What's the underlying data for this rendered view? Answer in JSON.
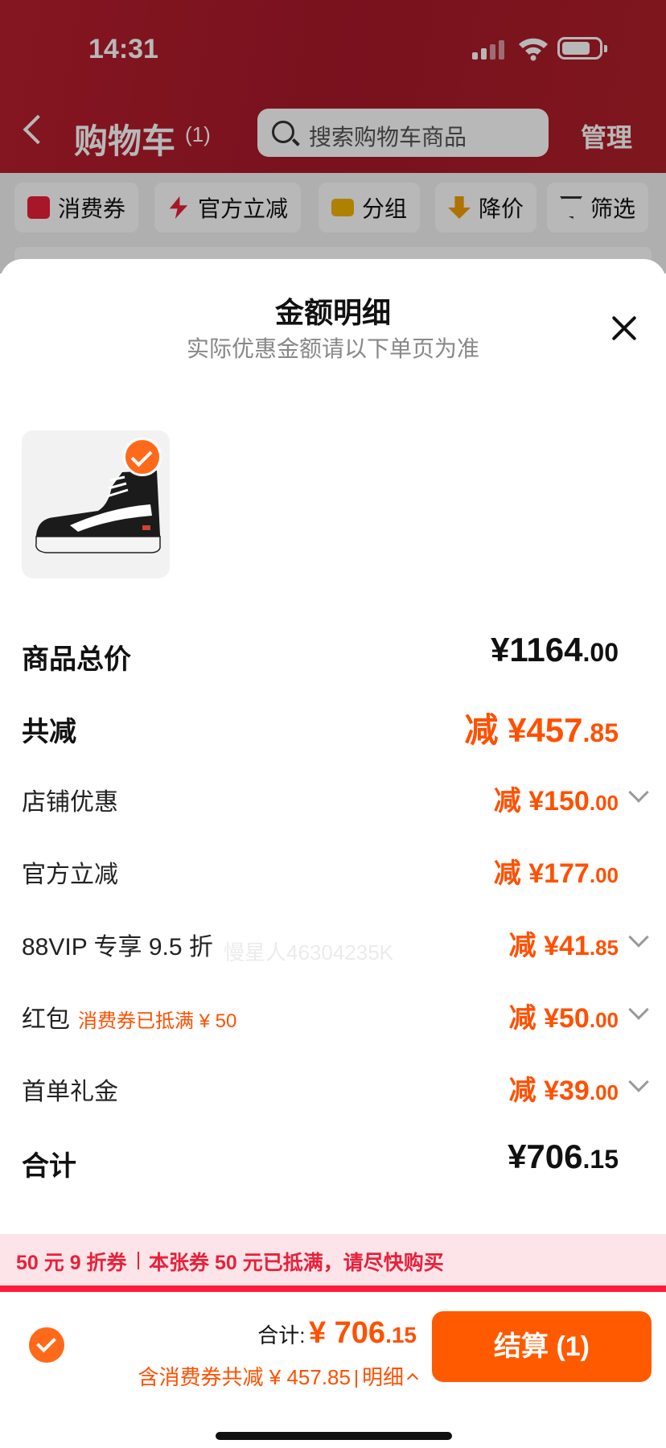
{
  "status": {
    "time": "14:31"
  },
  "nav": {
    "title": "购物车",
    "count": "(1)",
    "search_placeholder": "搜索购物车商品",
    "manage": "管理"
  },
  "filters": [
    {
      "label": "消费券",
      "icon": "coupon-icon"
    },
    {
      "label": "官方立减",
      "icon": "lightning-icon"
    },
    {
      "label": "分组",
      "icon": "folder-icon"
    },
    {
      "label": "降价",
      "icon": "price-down-icon"
    },
    {
      "label": "筛选",
      "icon": "filter-icon"
    }
  ],
  "sheet": {
    "title": "金额明细",
    "subtitle": "实际优惠金额请以下单页为准",
    "watermark": "慢星人46304235K"
  },
  "rows": {
    "total_price": {
      "label": "商品总价",
      "int": "¥1164",
      "dec": ".00"
    },
    "total_reduce": {
      "label": "共减",
      "int": "减 ¥457",
      "dec": ".85"
    },
    "shop": {
      "label": "店铺优惠",
      "int": "减 ¥150",
      "dec": ".00"
    },
    "official": {
      "label": "官方立减",
      "int": "减 ¥177",
      "dec": ".00"
    },
    "vip": {
      "label": "88VIP 专享 9.5 折",
      "int": "减 ¥41",
      "dec": ".85"
    },
    "redpacket": {
      "label": "红包",
      "note": "消费券已抵满 ¥ 50",
      "int": "减 ¥50",
      "dec": ".00"
    },
    "first": {
      "label": "首单礼金",
      "int": "减 ¥39",
      "dec": ".00"
    },
    "sum": {
      "label": "合计",
      "int": "¥706",
      "dec": ".15"
    }
  },
  "promo": {
    "left": "50 元 9 折券",
    "right": "本张券 50 元已抵满，请尽快购买"
  },
  "checkout": {
    "total_label": "合计:",
    "total_int": "¥ 706",
    "total_dec": ".15",
    "saving": "含消费券共减 ¥ 457.85",
    "detail": "明细",
    "pay_button": "结算 (1)"
  },
  "colors": {
    "accent": "#ff5000",
    "brand_red": "#b81f2e",
    "promo_red": "#e8203a"
  }
}
